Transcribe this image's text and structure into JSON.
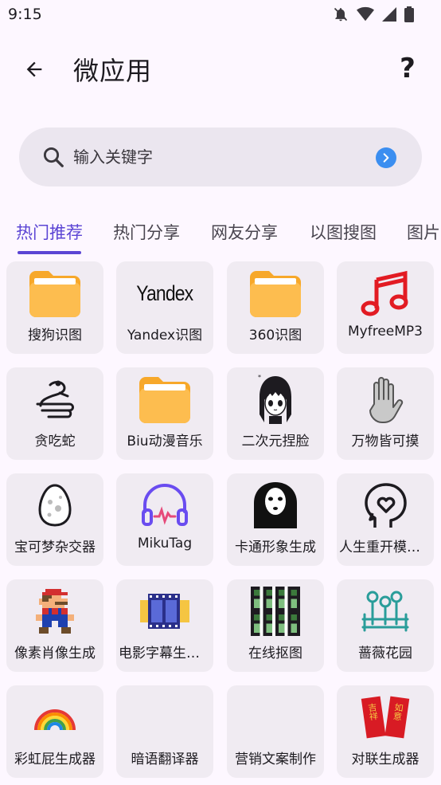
{
  "status_bar": {
    "time": "9:15"
  },
  "app_bar": {
    "title": "微应用",
    "help_label": "?"
  },
  "search": {
    "placeholder": "输入关键字",
    "value": ""
  },
  "tabs": [
    {
      "label": "热门推荐",
      "active": true
    },
    {
      "label": "热门分享",
      "active": false
    },
    {
      "label": "网友分享",
      "active": false
    },
    {
      "label": "以图搜图",
      "active": false
    },
    {
      "label": "图片",
      "active": false
    }
  ],
  "apps": [
    {
      "label": "搜狗识图",
      "icon": "folder-icon"
    },
    {
      "label": "Yandex识图",
      "icon": "yandex-logo",
      "logo_text": "Yandex"
    },
    {
      "label": "360识图",
      "icon": "folder-icon"
    },
    {
      "label": "MyfreeMP3",
      "icon": "music-note-icon"
    },
    {
      "label": "贪吃蛇",
      "icon": "snake-icon"
    },
    {
      "label": "Biu动漫音乐",
      "icon": "folder-icon"
    },
    {
      "label": "二次元捏脸",
      "icon": "anime-girl-icon"
    },
    {
      "label": "万物皆可摸",
      "icon": "hand-icon"
    },
    {
      "label": "宝可梦杂交器",
      "icon": "egg-icon"
    },
    {
      "label": "MikuTag",
      "icon": "headphones-icon"
    },
    {
      "label": "卡通形象生成",
      "icon": "no-face-icon"
    },
    {
      "label": "人生重开模拟器",
      "icon": "heart-head-icon"
    },
    {
      "label": "像素肖像生成",
      "icon": "pixel-mario-icon"
    },
    {
      "label": "电影字幕生成器",
      "icon": "film-strip-icon"
    },
    {
      "label": "在线抠图",
      "icon": "pixel-figures-icon"
    },
    {
      "label": "蔷薇花园",
      "icon": "garden-fence-icon"
    },
    {
      "label": "彩虹屁生成器",
      "icon": "rainbow-icon"
    },
    {
      "label": "暗语翻译器",
      "icon": ""
    },
    {
      "label": "营销文案制作",
      "icon": ""
    },
    {
      "label": "对联生成器",
      "icon": "couplet-icon",
      "couplet_left": "吉祥",
      "couplet_right": "如意"
    }
  ],
  "colors": {
    "accent": "#5b45d4",
    "folder": "#fdb84a",
    "music_red": "#e53935",
    "headphones": "#6a4cf0",
    "teal": "#2a9d9a"
  }
}
